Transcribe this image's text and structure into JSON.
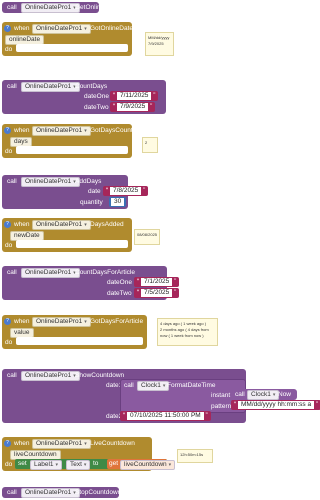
{
  "component": "OnlineDatePro1",
  "blocks": {
    "b1": {
      "call": "call",
      "component": "OnlineDatePro1",
      "method": "GetOnlineDate"
    },
    "b2": {
      "when": "when",
      "component": "OnlineDatePro1",
      "event": "GotOnlineDate",
      "param": "onlineDate",
      "do": "do",
      "note_lines": [
        "MM/dd/yyyy",
        "7/9/2025"
      ]
    },
    "b3": {
      "call": "call",
      "component": "OnlineDatePro1",
      "method": "CountDays",
      "arg1_label": "dateOne",
      "arg1_value": "7/11/2025",
      "arg2_label": "dateTwo",
      "arg2_value": "7/9/2025"
    },
    "b4": {
      "when": "when",
      "component": "OnlineDatePro1",
      "event": "GotDaysCount",
      "param": "days",
      "do": "do",
      "note_lines": [
        "2"
      ]
    },
    "b5": {
      "call": "call",
      "component": "OnlineDatePro1",
      "method": "AddDays",
      "arg1_label": "date",
      "arg1_value": "7/8/2025",
      "arg2_label": "quantity",
      "arg2_value": "30"
    },
    "b6": {
      "when": "when",
      "component": "OnlineDatePro1",
      "event": "DaysAdded",
      "param": "newDate",
      "do": "do",
      "note_lines": [
        "08/08/2025"
      ]
    },
    "b7": {
      "call": "call",
      "component": "OnlineDatePro1",
      "method": "CountDaysForArticle",
      "arg1_label": "dateOne",
      "arg1_value": "7/1/2025",
      "arg2_label": "dateTwo",
      "arg2_value": "7/5/2025"
    },
    "b8": {
      "when": "when",
      "component": "OnlineDatePro1",
      "event": "GotDaysForArticle",
      "param": "value",
      "do": "do",
      "note_lines": [
        "4 days ago ( 1 week ago )",
        "2 months ago ( 4 days from",
        "now ( 1 week from now )"
      ]
    },
    "b9": {
      "call": "call",
      "component": "OnlineDatePro1",
      "method": "ShowCountdown",
      "arg1_label": "date1",
      "clock_call": "call",
      "clock_component": "Clock1",
      "clock_method": "FormatDateTime",
      "instant_label": "instant",
      "now_call": "call",
      "now_component": "Clock1",
      "now_method": "Now",
      "pattern_label": "pattern",
      "pattern_value": "MM/dd/yyyy hh:mm:ss a",
      "arg2_label": "date2",
      "arg2_value": "07/10/2025 11:50:00 PM"
    },
    "b10": {
      "when": "when",
      "component": "OnlineDatePro1",
      "event": "LiveCountdown",
      "param": "liveCountdown",
      "do": "do",
      "set": "set",
      "set_component": "Label1",
      "set_prop": "Text",
      "to": "to",
      "get": "get",
      "get_var": "liveCountdown",
      "note_lines": [
        "12h:50m:15s"
      ]
    },
    "b11": {
      "call": "call",
      "component": "OnlineDatePro1",
      "method": "StopCountdown"
    }
  }
}
